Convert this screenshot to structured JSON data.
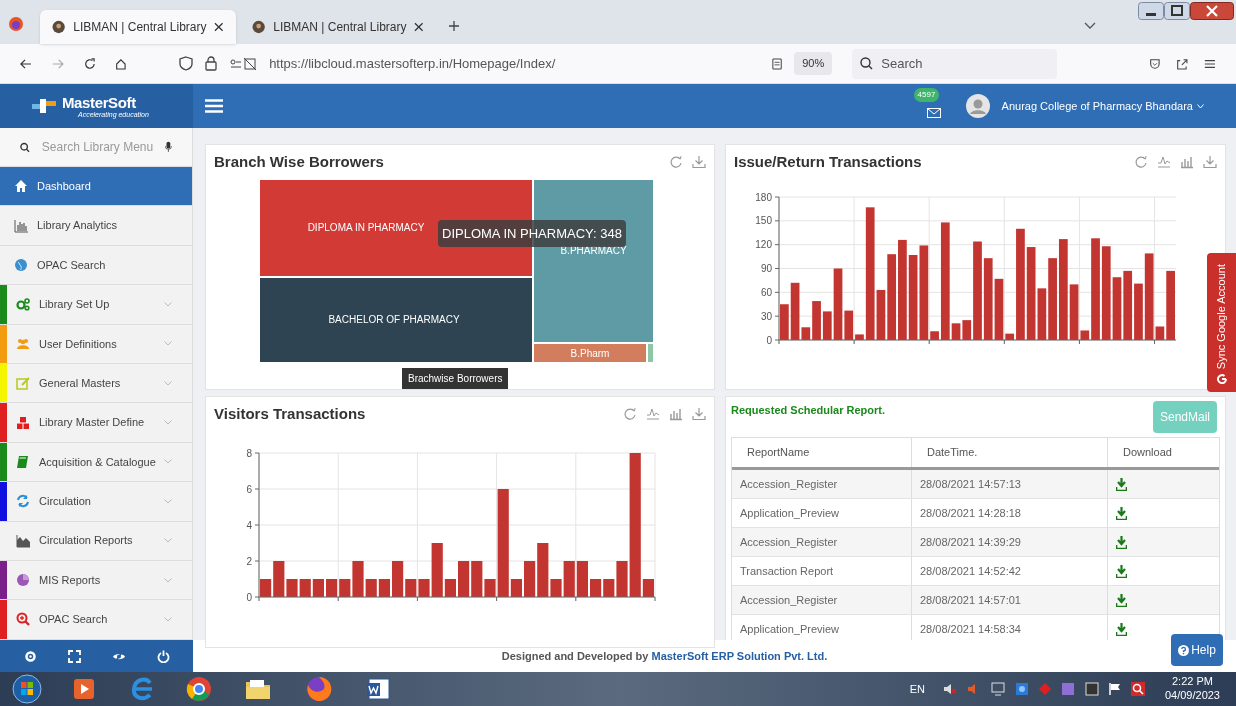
{
  "browser": {
    "tabs": [
      {
        "title": "LIBMAN | Central Library",
        "selected": true
      },
      {
        "title": "LIBMAN | Central Library",
        "selected": false
      }
    ],
    "url": "https://libcloud.mastersofterp.in/Homepage/Index/",
    "zoom": "90%",
    "search": {
      "placeholder": "Search"
    }
  },
  "header": {
    "logo": "MasterSoft",
    "tagline": "Accelerating education",
    "badge": "4597",
    "user": "Anurag College of Pharmacy Bhandara"
  },
  "sidebar": {
    "search": {
      "placeholder": "Search Library Menu"
    },
    "items": [
      {
        "label": "Dashboard",
        "selected": true,
        "kind": "link"
      },
      {
        "label": "Library Analytics",
        "selected": false,
        "kind": "link"
      },
      {
        "label": "OPAC Search",
        "selected": false,
        "kind": "link"
      },
      {
        "label": "Library Set Up",
        "selected": false,
        "kind": "group",
        "color": "#1a8a1a"
      },
      {
        "label": "User Definitions",
        "selected": false,
        "kind": "group",
        "color": "#f39c12"
      },
      {
        "label": "General Masters",
        "selected": false,
        "kind": "group",
        "color": "#f5f500"
      },
      {
        "label": "Library Master Define",
        "selected": false,
        "kind": "group",
        "color": "#e02020"
      },
      {
        "label": "Acquisition & Catalogue",
        "selected": false,
        "kind": "group",
        "color": "#1a8a1a"
      },
      {
        "label": "Circulation",
        "selected": false,
        "kind": "group",
        "color": "#1010e0"
      },
      {
        "label": "Circulation Reports",
        "selected": false,
        "kind": "group"
      },
      {
        "label": "MIS Reports",
        "selected": false,
        "kind": "group",
        "color": "#7b1f8a"
      },
      {
        "label": "OPAC Search",
        "selected": false,
        "kind": "group",
        "color": "#e02020"
      }
    ]
  },
  "branch_card": {
    "title": "Branch Wise Borrowers",
    "tiles": [
      {
        "label": "DIPLOMA IN PHARMACY",
        "color": "#d13a35"
      },
      {
        "label": "BACHELOR OF PHARMACY",
        "color": "#2e4453"
      },
      {
        "label": "B.PHARMACY",
        "color": "#5f9ba5"
      },
      {
        "label": "B.Pharm",
        "color": "#d37d5f"
      },
      {
        "color": "#8fc7a4"
      }
    ],
    "tooltip": "DIPLOMA IN PHARMACY: 348",
    "caption": "Brachwise Borrowers"
  },
  "issue_card": {
    "chart_data": {
      "type": "bar",
      "title": "Issue/Return Transactions",
      "values": [
        45,
        72,
        16,
        49,
        36,
        90,
        37,
        7,
        167,
        63,
        108,
        126,
        107,
        119,
        11,
        148,
        21,
        25,
        124,
        103,
        77,
        8,
        140,
        117,
        65,
        103,
        127,
        70,
        12,
        128,
        118,
        79,
        87,
        71,
        109,
        17,
        87
      ],
      "ylim": [
        0,
        180
      ],
      "grid": true,
      "yticks": [
        0,
        30,
        60,
        90,
        120,
        150,
        180
      ]
    }
  },
  "visitors_card": {
    "chart_data": {
      "type": "bar",
      "title": "Visitors Transactions",
      "values": [
        1,
        2,
        1,
        1,
        1,
        1,
        1,
        2,
        1,
        1,
        2,
        1,
        1,
        3,
        1,
        2,
        2,
        1,
        6,
        1,
        2,
        3,
        1,
        2,
        2,
        1,
        1,
        2,
        8,
        1
      ],
      "ylim": [
        0,
        8
      ],
      "grid": true,
      "yticks": [
        0,
        2,
        4,
        6,
        8
      ]
    }
  },
  "report_card": {
    "title": "Requested Schedular Report.",
    "button": "SendMail",
    "columns": [
      "ReportName",
      "DateTime.",
      "Download"
    ],
    "rows": [
      {
        "name": "Accession_Register",
        "datetime": "28/08/2021 14:57:13"
      },
      {
        "name": "Application_Preview",
        "datetime": "28/08/2021 14:28:18"
      },
      {
        "name": "Accession_Register",
        "datetime": "28/08/2021 14:39:29"
      },
      {
        "name": "Transaction Report",
        "datetime": "28/08/2021 14:52:42"
      },
      {
        "name": "Accession_Register",
        "datetime": "28/08/2021 14:57:01"
      },
      {
        "name": "Application_Preview",
        "datetime": "28/08/2021 14:58:34"
      }
    ]
  },
  "sync_tab": "Sync Google Account",
  "help_button": "Help",
  "footer": "Designed and Developed by **MasterSoft ERP Solution Pvt. Ltd.**",
  "taskbar": {
    "language": "EN",
    "time": "2:22 PM",
    "date": "04/09/2023"
  }
}
